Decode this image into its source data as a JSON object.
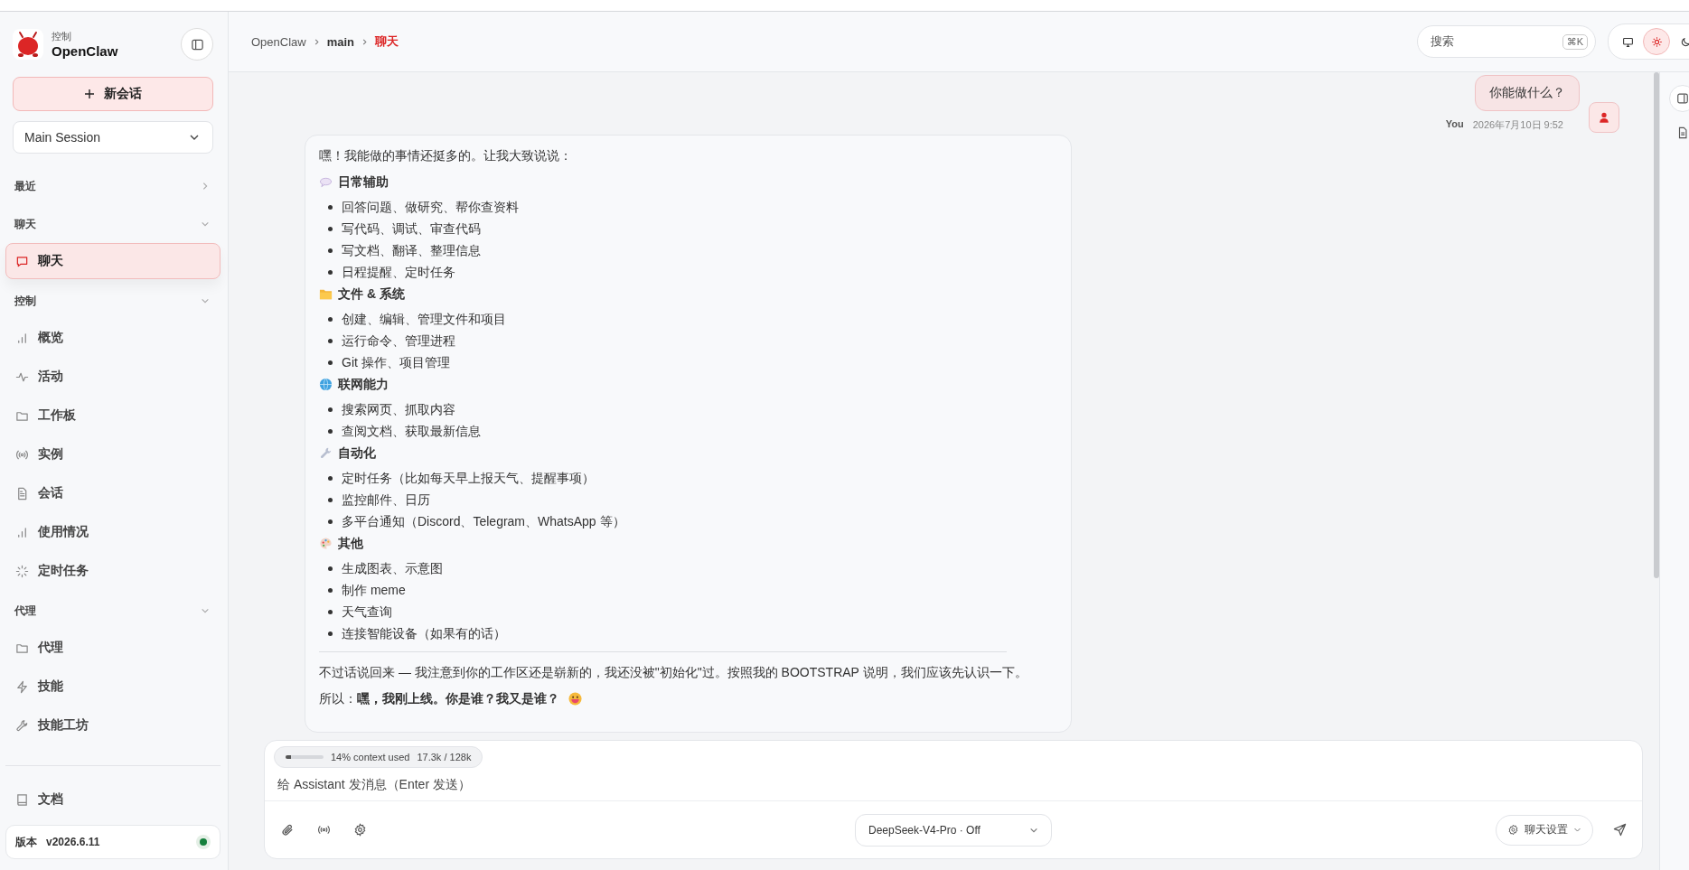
{
  "sidebar": {
    "brand": {
      "subtitle": "控制",
      "title": "OpenClaw"
    },
    "new_chat": "新会话",
    "session_select": "Main Session",
    "sections": [
      {
        "label": "最近",
        "expanded": false
      },
      {
        "label": "聊天",
        "expanded": true,
        "items": [
          {
            "label": "聊天",
            "selected": true
          }
        ]
      },
      {
        "label": "控制",
        "expanded": true,
        "items": [
          {
            "label": "概览",
            "selected": false
          },
          {
            "label": "活动",
            "selected": false
          },
          {
            "label": "工作板",
            "selected": false
          },
          {
            "label": "实例",
            "selected": false
          },
          {
            "label": "会话",
            "selected": false
          },
          {
            "label": "使用情况",
            "selected": false
          },
          {
            "label": "定时任务",
            "selected": false
          }
        ]
      },
      {
        "label": "代理",
        "expanded": true,
        "items": [
          {
            "label": "代理",
            "selected": false
          },
          {
            "label": "技能",
            "selected": false
          },
          {
            "label": "技能工坊",
            "selected": false
          }
        ]
      }
    ],
    "docs": "文档",
    "version": {
      "label": "版本",
      "value": "v2026.6.11",
      "online": true
    }
  },
  "header": {
    "breadcrumb": [
      "OpenClaw",
      "main",
      "聊天"
    ],
    "search": {
      "placeholder": "搜索",
      "shortcut": "⌘K"
    },
    "theme": [
      {
        "kind": "system",
        "selected": false
      },
      {
        "kind": "light",
        "selected": true
      },
      {
        "kind": "dark",
        "selected": false
      }
    ]
  },
  "messages": [
    {
      "kind": "user",
      "text": "你能做什么？",
      "sender": "You",
      "time": "2026年7月10日 9:52"
    },
    {
      "kind": "assistant",
      "blocks": [
        {
          "kind": "paragraph",
          "text": "嘿！我能做的事情还挺多的。让我大致说说："
        },
        {
          "kind": "heading",
          "text": "日常辅助"
        },
        {
          "kind": "list",
          "items": [
            "回答问题、做研究、帮你查资料",
            "写代码、调试、审查代码",
            "写文档、翻译、整理信息",
            "日程提醒、定时任务"
          ]
        },
        {
          "kind": "heading",
          "text": "文件 & 系统"
        },
        {
          "kind": "list",
          "items": [
            "创建、编辑、管理文件和项目",
            "运行命令、管理进程",
            "Git 操作、项目管理"
          ]
        },
        {
          "kind": "heading",
          "text": "联网能力"
        },
        {
          "kind": "list",
          "items": [
            "搜索网页、抓取内容",
            "查阅文档、获取最新信息"
          ]
        },
        {
          "kind": "heading",
          "text": "自动化"
        },
        {
          "kind": "list",
          "items": [
            "定时任务（比如每天早上报天气、提醒事项）",
            "监控邮件、日历",
            "多平台通知（Discord、Telegram、WhatsApp 等）"
          ]
        },
        {
          "kind": "heading",
          "text": "其他"
        },
        {
          "kind": "list",
          "items": [
            "生成图表、示意图",
            "制作 meme",
            "天气查询",
            "连接智能设备（如果有的话）"
          ]
        },
        {
          "kind": "rule"
        },
        {
          "kind": "paragraph",
          "text": "不过话说回来 — 我注意到你的工作区还是崭新的，我还没被\"初始化\"过。按照我的 BOOTSTRAP 说明，我们应该先认识一下。"
        },
        {
          "kind": "paragraph",
          "text": "所以：**嘿，我刚上线。你是谁？我又是谁？**",
          "emoji": true
        }
      ]
    }
  ],
  "composer": {
    "context": {
      "level": 0.14,
      "text": "14% context used",
      "tokens": "17.3k / 128k"
    },
    "placeholder": "给 Assistant 发消息（Enter 发送）",
    "model": "DeepSeek-V4-Pro · Off",
    "settings": "聊天设置"
  }
}
